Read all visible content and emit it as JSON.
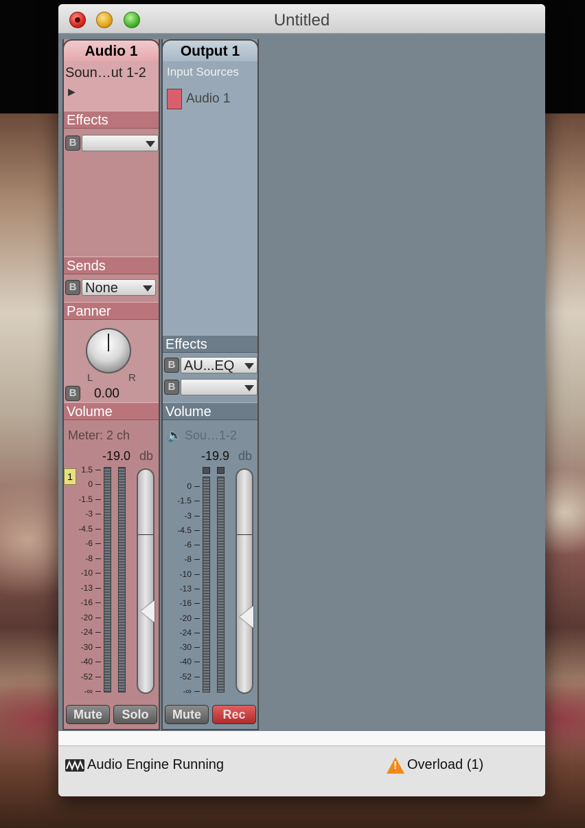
{
  "window": {
    "title": "Untitled"
  },
  "audio_strip": {
    "tab_label": "Audio 1",
    "input_label": "Soun…ut 1-2",
    "effects_label": "Effects",
    "effects_bypass": "B",
    "sends_label": "Sends",
    "sends_bypass": "B",
    "sends_value": "None",
    "panner_label": "Panner",
    "panner_left": "L",
    "panner_right": "R",
    "panner_bypass": "B",
    "panner_value": "0.00",
    "volume_label": "Volume",
    "meter_label": "Meter: 2 ch",
    "level_value": "-19.0",
    "level_unit": "db",
    "marker_label": "1",
    "mute_label": "Mute",
    "solo_label": "Solo",
    "fader_db": -19.0
  },
  "output_strip": {
    "tab_label": "Output 1",
    "input_sources_label": "Input Sources",
    "source_item": "Audio 1",
    "effects_label": "Effects",
    "effect1_bypass": "B",
    "effect1_value": "AU...EQ",
    "effect2_bypass": "B",
    "volume_label": "Volume",
    "output_device": "Sou…1-2",
    "level_value": "-19.9",
    "level_unit": "db",
    "mute_label": "Mute",
    "rec_label": "Rec",
    "fader_db": -19.9
  },
  "meter_scale": [
    "1.5",
    "0",
    "-1.5",
    "-3",
    "-4.5",
    "-6",
    "-8",
    "-10",
    "-13",
    "-16",
    "-20",
    "-24",
    "-30",
    "-40",
    "-52",
    "-∞"
  ],
  "output_meter_scale": [
    "0",
    "-1.5",
    "-3",
    "-4.5",
    "-6",
    "-8",
    "-10",
    "-13",
    "-16",
    "-20",
    "-24",
    "-30",
    "-40",
    "-52",
    "-∞"
  ],
  "status": {
    "engine_text": "Audio Engine Running",
    "overload_text": "Overload (1)"
  },
  "colors": {
    "audio_strip": "#bf8c90",
    "output_strip": "#8a9aa8",
    "rec_button": "#c03a3a",
    "warning": "#f08a1a"
  }
}
